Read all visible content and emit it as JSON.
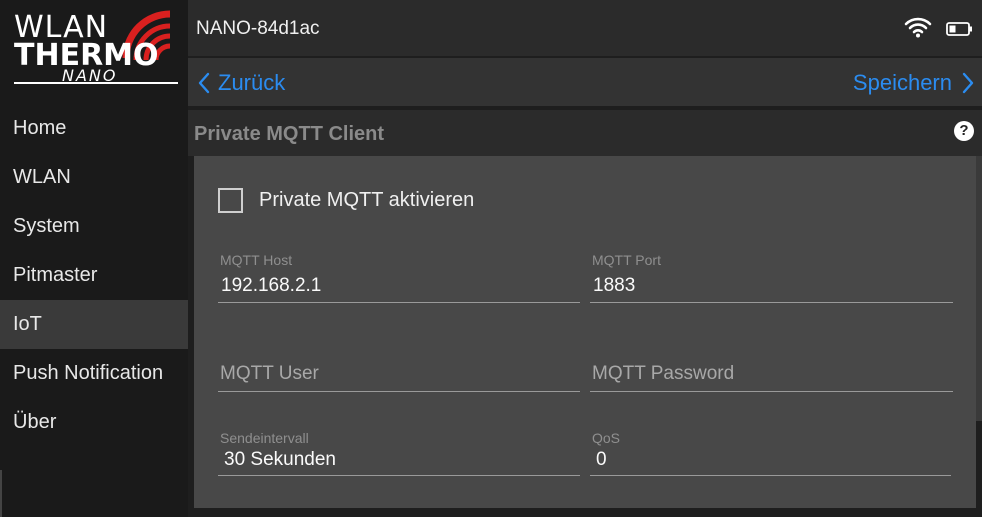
{
  "logo": {
    "line1": "WLAN",
    "line2": "THERMO",
    "line3": "NANO"
  },
  "sidebar": {
    "items": [
      {
        "label": "Home"
      },
      {
        "label": "WLAN"
      },
      {
        "label": "System"
      },
      {
        "label": "Pitmaster"
      },
      {
        "label": "IoT"
      },
      {
        "label": "Push Notification"
      },
      {
        "label": "Über"
      }
    ],
    "active_item": "IoT"
  },
  "topbar": {
    "device_name": "NANO-84d1ac",
    "wifi_icon": "wifi-icon",
    "battery_icon": "battery-icon"
  },
  "actionbar": {
    "back_label": "Zurück",
    "save_label": "Speichern"
  },
  "section": {
    "title": "Private MQTT Client",
    "help_symbol": "?"
  },
  "form": {
    "enable_checkbox": {
      "label": "Private MQTT aktivieren",
      "checked": false
    },
    "mqtt_host": {
      "label": "MQTT Host",
      "value": "192.168.2.1"
    },
    "mqtt_port": {
      "label": "MQTT Port",
      "value": "1883"
    },
    "mqtt_user": {
      "placeholder": "MQTT User",
      "value": ""
    },
    "mqtt_password": {
      "placeholder": "MQTT Password",
      "value": ""
    },
    "send_interval": {
      "label": "Sendeintervall",
      "value": "30 Sekunden"
    },
    "qos": {
      "label": "QoS",
      "value": "0"
    }
  },
  "colors": {
    "accent": "#2b8cf0",
    "logo_red": "#d9201f",
    "panel": "#484848",
    "background": "#1e1e1e"
  }
}
